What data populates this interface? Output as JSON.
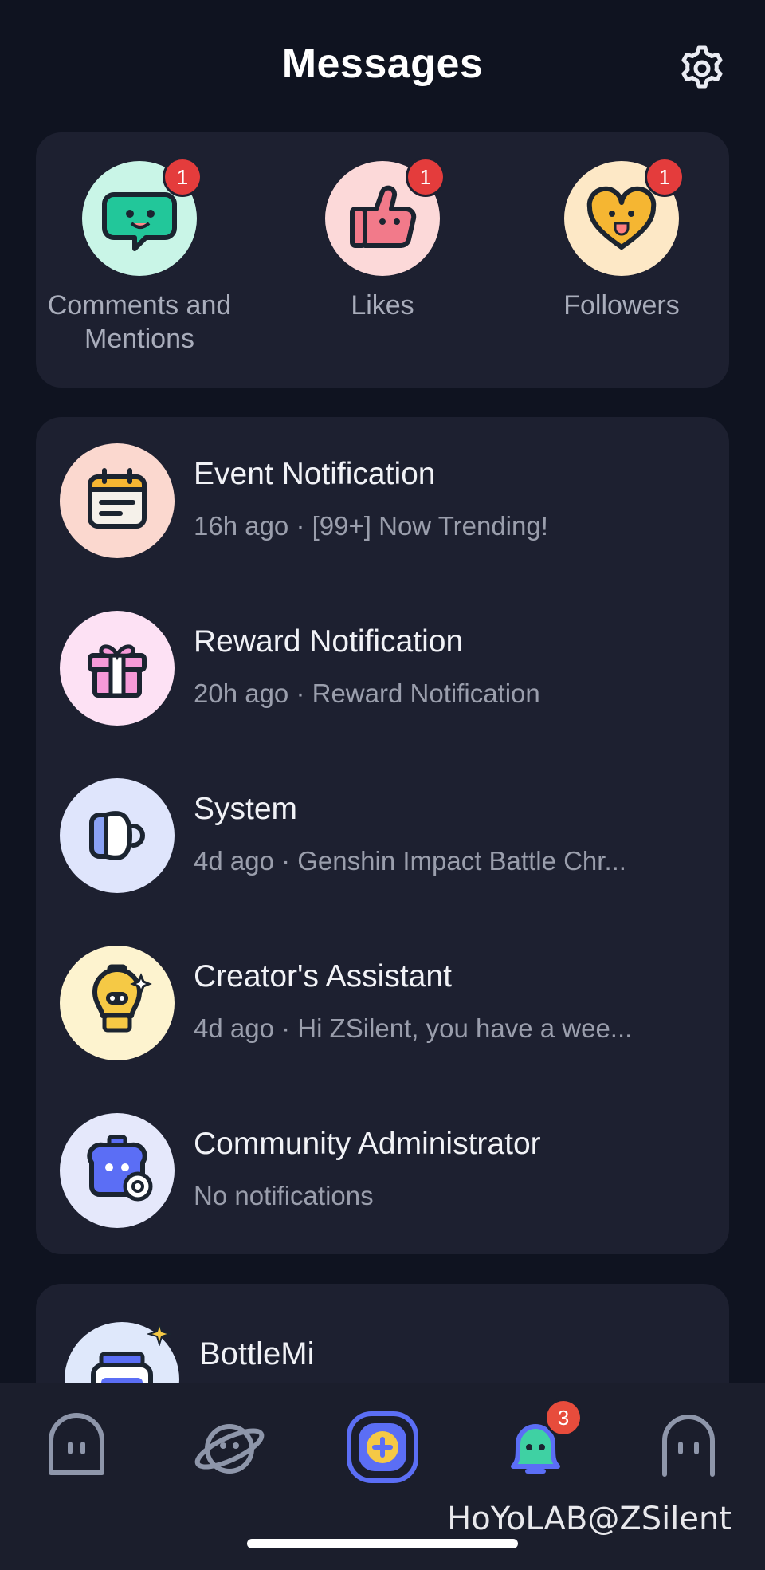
{
  "header": {
    "title": "Messages",
    "settings_icon": "gear-icon"
  },
  "quick_actions": [
    {
      "label": "Comments and Mentions",
      "badge": "1",
      "icon": "comment-bubble-icon",
      "bg": "#c9f5e7"
    },
    {
      "label": "Likes",
      "badge": "1",
      "icon": "thumbs-up-icon",
      "bg": "#fcd9d9"
    },
    {
      "label": "Followers",
      "badge": "1",
      "icon": "heart-icon",
      "bg": "#fde8c6"
    }
  ],
  "notifications": [
    {
      "title": "Event Notification",
      "time": "16h ago",
      "preview": "[99+] Now Trending!",
      "icon": "calendar-icon",
      "bg": "#fbd8cf"
    },
    {
      "title": "Reward Notification",
      "time": "20h ago",
      "preview": "Reward Notification",
      "icon": "gift-icon",
      "bg": "#fde1f4"
    },
    {
      "title": "System",
      "time": "4d ago",
      "preview": "Genshin Impact Battle Chr...",
      "icon": "megaphone-icon",
      "bg": "#dfe5fc"
    },
    {
      "title": "Creator's Assistant",
      "time": "4d ago",
      "preview": "Hi ZSilent, you have a wee...",
      "icon": "lightbulb-mascot-icon",
      "bg": "#fdf3cf"
    },
    {
      "title": "Community Administrator",
      "time": "",
      "preview": "No notifications",
      "icon": "admin-mascot-icon",
      "bg": "#e5e8fb"
    }
  ],
  "chats": [
    {
      "name": "BottleMi",
      "icon": "bottlemi-avatar"
    }
  ],
  "tabbar": {
    "items": [
      {
        "name": "home",
        "icon": "home-ghost-icon"
      },
      {
        "name": "explore",
        "icon": "planet-icon"
      },
      {
        "name": "create",
        "icon": "plus-icon"
      },
      {
        "name": "notifications",
        "icon": "bell-icon",
        "badge": "3"
      },
      {
        "name": "profile",
        "icon": "profile-ghost-icon"
      }
    ]
  },
  "watermark": "HoYoLAB@ZSilent",
  "colors": {
    "background": "#0f1320",
    "card": "#1d2030",
    "badge": "#e43c3c",
    "accent": "#5b6ef5"
  }
}
